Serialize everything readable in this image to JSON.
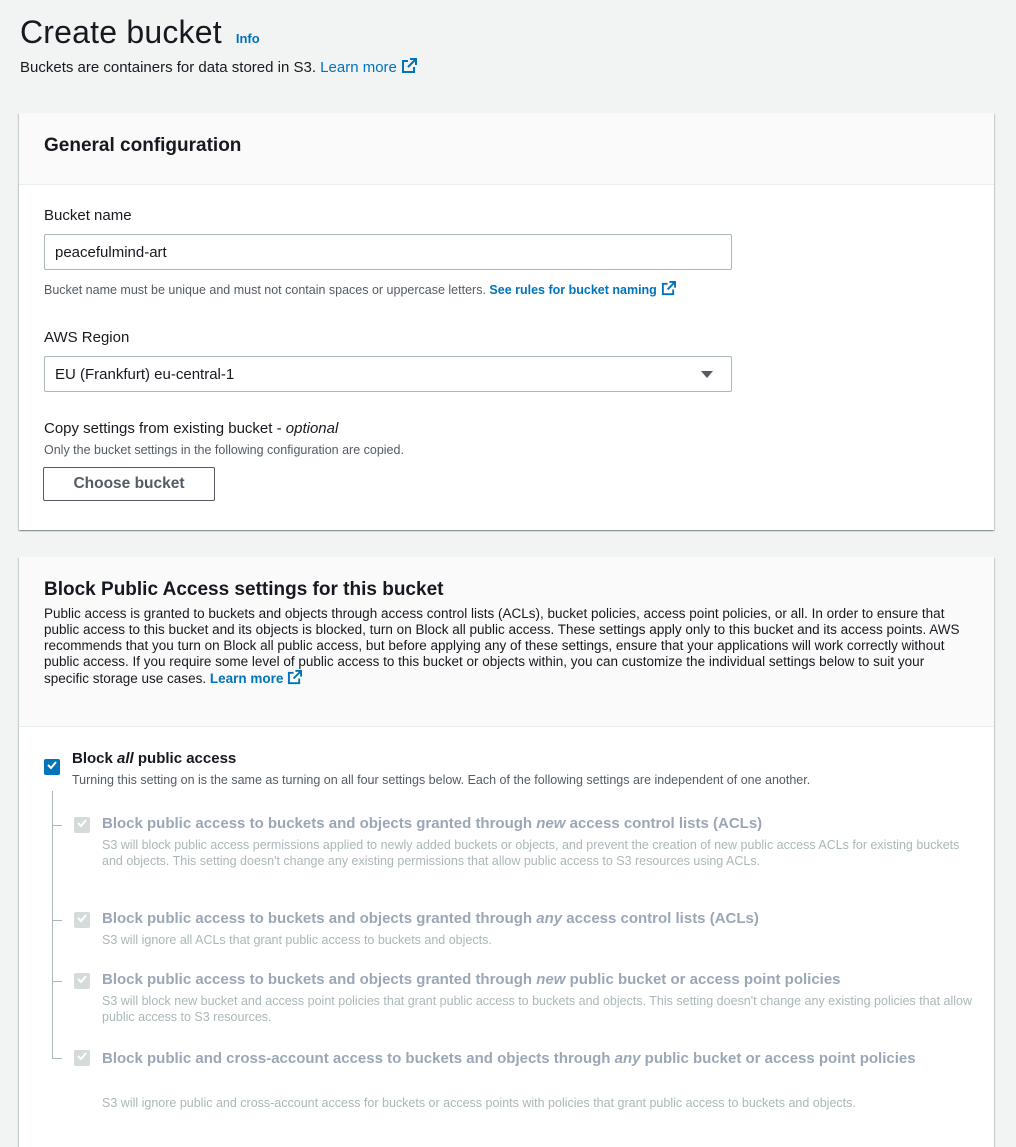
{
  "header": {
    "title": "Create bucket",
    "info": "Info",
    "subtitle": "Buckets are containers for data stored in S3.",
    "learn_more": "Learn more"
  },
  "general": {
    "heading": "General configuration",
    "bucket_name_label": "Bucket name",
    "bucket_name_value": "peacefulmind-art",
    "bucket_name_hint": "Bucket name must be unique and must not contain spaces or uppercase letters.",
    "bucket_name_rules_link": "See rules for bucket naming",
    "region_label": "AWS Region",
    "region_value": "EU (Frankfurt) eu-central-1",
    "copy_label": "Copy settings from existing bucket -",
    "copy_optional": "optional",
    "copy_hint": "Only the bucket settings in the following configuration are copied.",
    "choose_bucket": "Choose bucket"
  },
  "block": {
    "heading": "Block Public Access settings for this bucket",
    "description": "Public access is granted to buckets and objects through access control lists (ACLs), bucket policies, access point policies, or all. In order to ensure that public access to this bucket and its objects is blocked, turn on Block all public access. These settings apply only to this bucket and its access points. AWS recommends that you turn on Block all public access, but before applying any of these settings, ensure that your applications will work correctly without public access. If you require some level of public access to this bucket or objects within, you can customize the individual settings below to suit your specific storage use cases.",
    "learn_more": "Learn more",
    "all": {
      "pre": "Block ",
      "em": "all",
      "post": " public access",
      "desc": "Turning this setting on is the same as turning on all four settings below. Each of the following settings are independent of one another.",
      "checked": true
    },
    "options": [
      {
        "pre": "Block public access to buckets and objects granted through ",
        "em": "new",
        "post": " access control lists (ACLs)",
        "desc": "S3 will block public access permissions applied to newly added buckets or objects, and prevent the creation of new public access ACLs for existing buckets and objects. This setting doesn't change any existing permissions that allow public access to S3 resources using ACLs.",
        "checked": true
      },
      {
        "pre": "Block public access to buckets and objects granted through ",
        "em": "any",
        "post": " access control lists (ACLs)",
        "desc": "S3 will ignore all ACLs that grant public access to buckets and objects.",
        "checked": true
      },
      {
        "pre": "Block public access to buckets and objects granted through ",
        "em": "new",
        "post": " public bucket or access point policies",
        "desc": "S3 will block new bucket and access point policies that grant public access to buckets and objects. This setting doesn't change any existing policies that allow public access to S3 resources.",
        "checked": true
      },
      {
        "pre": "Block public and cross-account access to buckets and objects through ",
        "em": "any",
        "post": " public bucket or access point policies",
        "desc": "S3 will ignore public and cross-account access for buckets or access points with policies that grant public access to buckets and objects.",
        "checked": true
      }
    ]
  },
  "colors": {
    "link": "#0073bb",
    "checkbox_on": "#0073bb",
    "checkbox_disabled": "#d5dbdb"
  },
  "icons": {
    "external": "external-link-icon",
    "check": "check-icon",
    "dropdown": "caret-down-icon"
  }
}
